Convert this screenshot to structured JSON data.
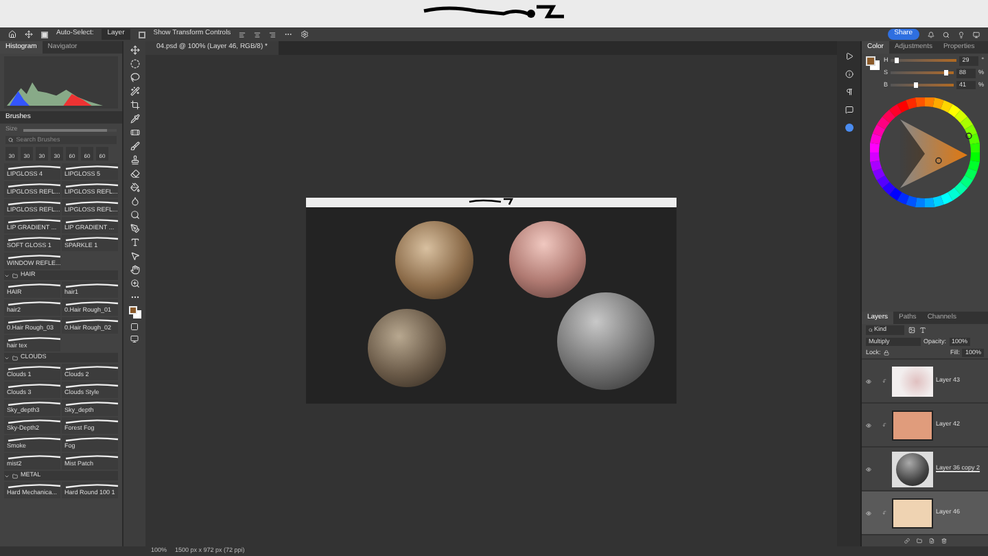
{
  "options_bar": {
    "auto_select_label": "Auto-Select:",
    "auto_select_checked": true,
    "target": "Layer",
    "transform_label": "Show Transform Controls",
    "transform_checked": false,
    "share": "Share"
  },
  "document_tab": {
    "title": "04.psd @ 100% (Layer 46, RGB/8) *"
  },
  "left_tabs": [
    {
      "label": "Histogram",
      "selected": true
    },
    {
      "label": "Navigator",
      "selected": false
    }
  ],
  "brushes": {
    "title": "Brushes",
    "size_label": "Size",
    "size_slider": {
      "level": 0.9
    },
    "search_placeholder": "Search Brushes",
    "presets": [
      "30",
      "30",
      "30",
      "30",
      "60",
      "60",
      "60"
    ],
    "items": [
      "LIPGLOSS 4",
      "LIPGLOSS 5",
      "LIPGLOSS REFL...",
      "LIPGLOSS REFL...",
      "LIPGLOSS REFL...",
      "LIPGLOSS REFL...",
      "LIP GRADIENT ...",
      "LIP GRADIENT ...",
      "SOFT GLOSS 1",
      "SPARKLE 1",
      "WINDOW REFLE..."
    ],
    "groups": [
      {
        "name": "HAIR",
        "expanded": true,
        "items": [
          "HAIR",
          "hair1",
          "hair2",
          "0.Hair Rough_01",
          "0.Hair Rough_03",
          "0.Hair Rough_02",
          "hair tex"
        ]
      },
      {
        "name": "CLOUDS",
        "expanded": true,
        "items": [
          "Clouds 1",
          "Clouds 2",
          "Clouds 3",
          "Clouds Style",
          "Sky_depth3",
          "Sky_depth",
          "Sky-Depth2",
          "Forest Fog",
          "Smoke",
          "Fog",
          "mist2",
          "Mist Patch"
        ]
      },
      {
        "name": "METAL",
        "expanded": true,
        "items": [
          "Hard Mechanica...",
          "Hard Round 100 1"
        ]
      }
    ]
  },
  "color_tabs": [
    {
      "label": "Color",
      "selected": true
    },
    {
      "label": "Adjustments",
      "selected": false
    },
    {
      "label": "Properties",
      "selected": false
    }
  ],
  "color_sliders": [
    {
      "label": "H",
      "value": "29",
      "unit": "°",
      "level": 0.08
    },
    {
      "label": "S",
      "value": "88",
      "unit": "%",
      "level": 0.88
    },
    {
      "label": "B",
      "value": "41",
      "unit": "%",
      "level": 0.41
    }
  ],
  "layers_tabs": [
    {
      "label": "Layers",
      "selected": true
    },
    {
      "label": "Paths",
      "selected": false
    },
    {
      "label": "Channels",
      "selected": false
    }
  ],
  "layers_controls": {
    "filter": "Kind",
    "blend_mode": "Multiply",
    "opacity_label": "Opacity:",
    "opacity": "100%",
    "lock_label": "Lock:",
    "fill_label": "Fill:",
    "fill": "100%"
  },
  "layers": [
    {
      "name": "Layer 43",
      "kind": "texture",
      "clipped": true,
      "visible": true,
      "selected": false
    },
    {
      "name": "Layer 42",
      "kind": "solid",
      "color": "#e09c7c",
      "clipped": true,
      "visible": true,
      "selected": false
    },
    {
      "name": "Layer 36 copy 2",
      "kind": "sphere",
      "clipped": false,
      "visible": true,
      "selected": false
    },
    {
      "name": "Layer 46",
      "kind": "solid",
      "color": "#efd3b2",
      "clipped": true,
      "visible": true,
      "selected": true
    }
  ],
  "status_bar": {
    "zoom": "100%",
    "size": "1500 px x 972 px (72 ppi)"
  }
}
